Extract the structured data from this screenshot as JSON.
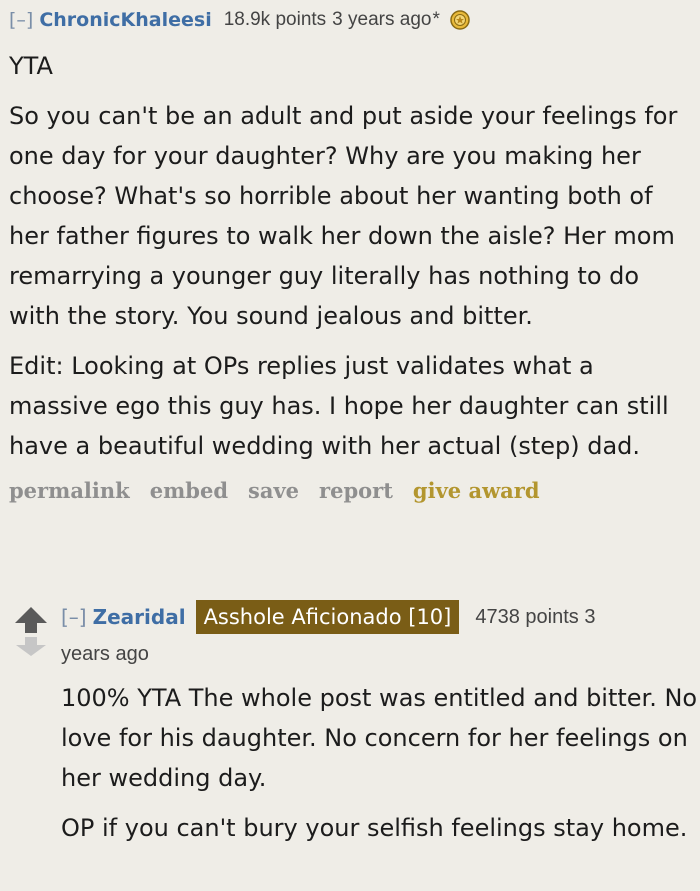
{
  "top_comment": {
    "expand_label": "[–]",
    "author": "ChronicKhaleesi",
    "score": "18.9k points",
    "time": "3 years ago",
    "edited_mark": "*",
    "award_icon": "award-medal-icon",
    "verdict": "YTA",
    "paragraphs": [
      "So you can't be an adult and put aside your feelings for one day for your daughter? Why are you making her choose? What's so horrible about her wanting both of her father figures to walk her down the aisle? Her mom remarrying a younger guy literally has nothing to do with the story. You sound jealous and bitter.",
      "Edit: Looking at OPs replies just validates what a massive ego this guy has. I hope her daughter can still have a beautiful wedding with her actual (step) dad."
    ],
    "buttons": {
      "permalink": "permalink",
      "embed": "embed",
      "save": "save",
      "report": "report",
      "give_award": "give award"
    }
  },
  "reply": {
    "expand_label": "[–]",
    "author": "Zearidal",
    "flair": "Asshole Aficionado [10]",
    "score_time_line1": "4738 points 3",
    "score_time_line2": "years ago",
    "paragraphs": [
      "100% YTA The whole post was entitled and bitter. No love for his daughter. No concern for her feelings on her wedding day.",
      "OP if you can't bury your selfish feelings stay home."
    ],
    "colors": {
      "flair_bg": "#7a5d16",
      "author": "#3f6ea5",
      "upvote": "#5a5a5a",
      "downvote": "#c6c6c6"
    }
  }
}
